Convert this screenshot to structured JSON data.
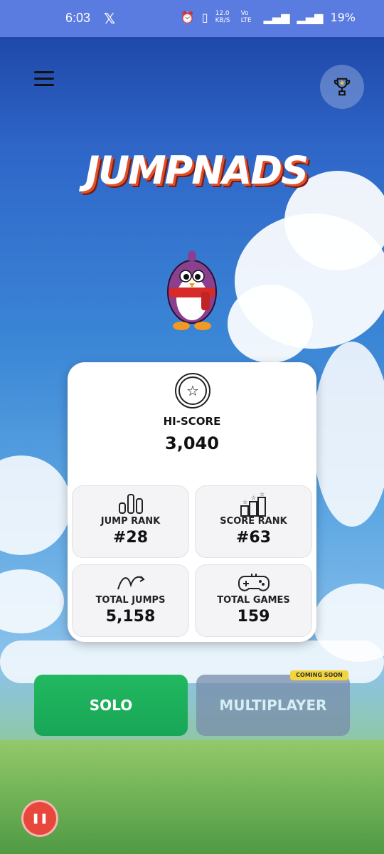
{
  "status_bar": {
    "time": "6:03",
    "x_icon": "x-logo-icon",
    "net_speed": "12.0 KB/S",
    "volte": "Vo LTE",
    "network": "4G",
    "battery": "19%"
  },
  "header": {
    "menu_icon": "hamburger-menu-icon",
    "leaderboard_icon": "trophy-icon"
  },
  "logo": {
    "text": "JUMPNADS"
  },
  "stats": {
    "hi_score_label": "HI-SCORE",
    "hi_score_value": "3,040",
    "tiles": [
      {
        "label": "JUMP RANK",
        "value": "#28",
        "icon": "bar-chart-icon"
      },
      {
        "label": "SCORE RANK",
        "value": "#63",
        "icon": "podium-stars-icon"
      },
      {
        "label": "TOTAL JUMPS",
        "value": "5,158",
        "icon": "jump-arrow-icon"
      },
      {
        "label": "TOTAL GAMES",
        "value": "159",
        "icon": "gamepad-icon"
      }
    ]
  },
  "buttons": {
    "solo": "SOLO",
    "multiplayer": "MULTIPLAYER",
    "badge": "COMING SOON"
  },
  "colors": {
    "solo": "#22b861",
    "pause": "#e8473c",
    "accent_logo": "#e2502a"
  }
}
